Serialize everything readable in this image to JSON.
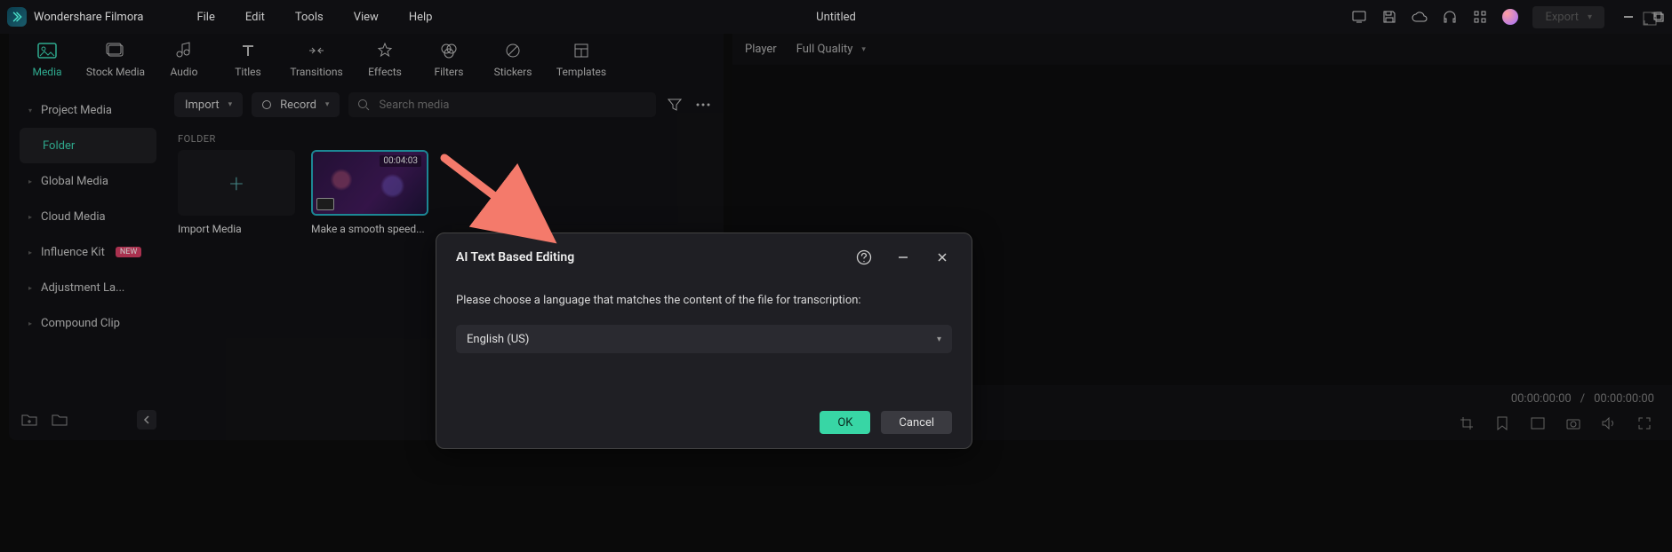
{
  "app": {
    "title": "Wondershare Filmora",
    "document": "Untitled"
  },
  "menubar": [
    "File",
    "Edit",
    "Tools",
    "View",
    "Help"
  ],
  "export_label": "Export",
  "tabs": [
    {
      "label": "Media",
      "icon": "media"
    },
    {
      "label": "Stock Media",
      "icon": "stock"
    },
    {
      "label": "Audio",
      "icon": "audio"
    },
    {
      "label": "Titles",
      "icon": "titles"
    },
    {
      "label": "Transitions",
      "icon": "transitions"
    },
    {
      "label": "Effects",
      "icon": "effects"
    },
    {
      "label": "Filters",
      "icon": "filters"
    },
    {
      "label": "Stickers",
      "icon": "stickers"
    },
    {
      "label": "Templates",
      "icon": "templates"
    }
  ],
  "sidebar": {
    "items": [
      {
        "label": "Project Media",
        "expandable": true
      },
      {
        "label": "Folder",
        "selected": true,
        "indent": true
      },
      {
        "label": "Global Media",
        "expandable": true
      },
      {
        "label": "Cloud Media",
        "expandable": true
      },
      {
        "label": "Influence Kit",
        "expandable": true,
        "badge": "NEW"
      },
      {
        "label": "Adjustment La...",
        "expandable": true
      },
      {
        "label": "Compound Clip",
        "expandable": true
      }
    ]
  },
  "toolbar": {
    "import_label": "Import",
    "record_label": "Record",
    "search_placeholder": "Search media"
  },
  "section_label": "FOLDER",
  "cards": {
    "import_label": "Import Media",
    "clip": {
      "label": "Make a smooth speed...",
      "duration": "00:04:03"
    }
  },
  "player": {
    "tab": "Player",
    "quality": "Full Quality",
    "time_current": "00:00:00:00",
    "time_total": "00:00:00:00"
  },
  "modal": {
    "title": "AI Text Based Editing",
    "prompt": "Please choose a language that matches the content of the file for transcription:",
    "language": "English (US)",
    "ok": "OK",
    "cancel": "Cancel"
  }
}
